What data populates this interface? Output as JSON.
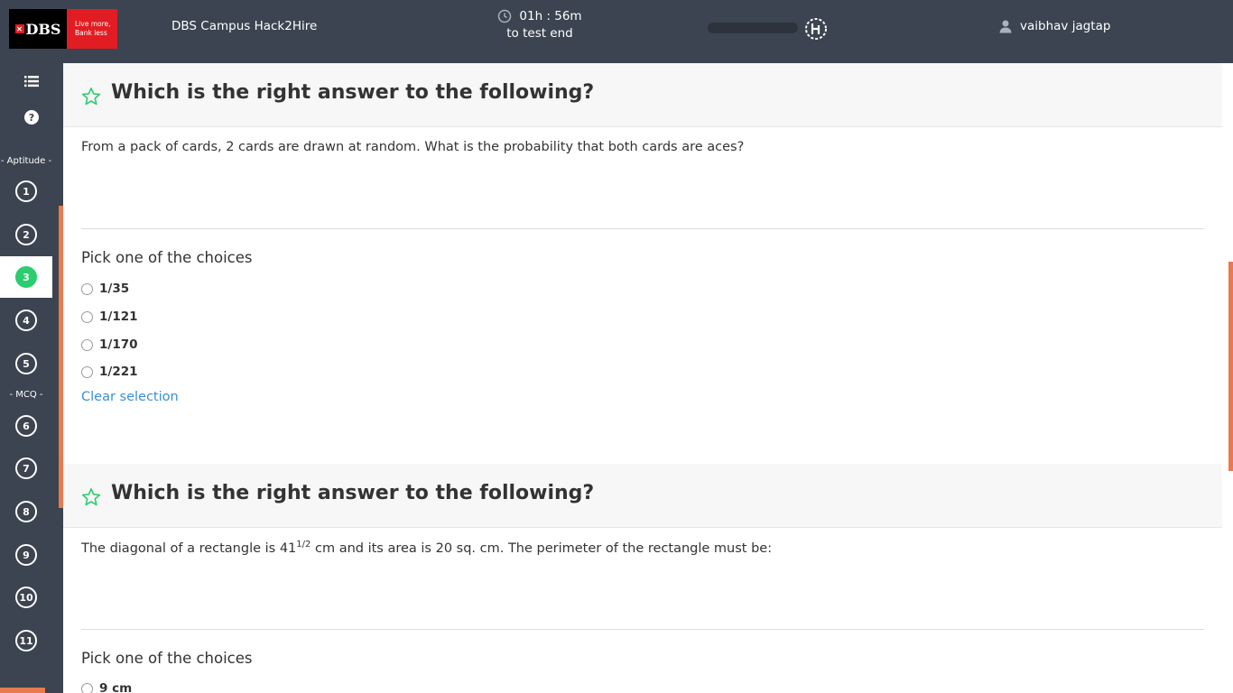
{
  "header": {
    "logo_text": "DBS",
    "logo_tagline_1": "Live more,",
    "logo_tagline_2": "Bank less",
    "app_title": "DBS Campus Hack2Hire",
    "timer_value": "01h : 56m",
    "timer_label": "to test end",
    "progress_fraction": 0.0,
    "user_name": "vaibhav jagtap"
  },
  "sidebar": {
    "sections": [
      {
        "label": "- Aptitude -"
      },
      {
        "label": "- MCQ -"
      }
    ],
    "questions": [
      "1",
      "2",
      "3",
      "4",
      "5",
      "6",
      "7",
      "8",
      "9",
      "10",
      "11"
    ],
    "active_question": "3"
  },
  "questions": [
    {
      "title": "Which is the right answer to the following?",
      "text": "From a pack of cards, 2 cards are drawn at random. What is the probability that both cards are aces?",
      "pick_label": "Pick one of the choices",
      "choices": [
        "1/35",
        "1/121",
        "1/170",
        "1/221"
      ],
      "clear_label": "Clear selection"
    },
    {
      "title": "Which is the right answer to the following?",
      "text_before": "The diagonal of a rectangle is 41",
      "text_sup": "1/2",
      "text_after": " cm and its area is 20 sq. cm. The perimeter of the rectangle must be:",
      "pick_label": "Pick one of the choices",
      "choices": [
        "9 cm"
      ]
    }
  ],
  "colors": {
    "header_bg": "#3b4450",
    "accent": "#e77b4f",
    "active": "#2ecc71",
    "star": "#2ecc71",
    "link": "#3a8fd6",
    "brand_red": "#e21c23"
  }
}
